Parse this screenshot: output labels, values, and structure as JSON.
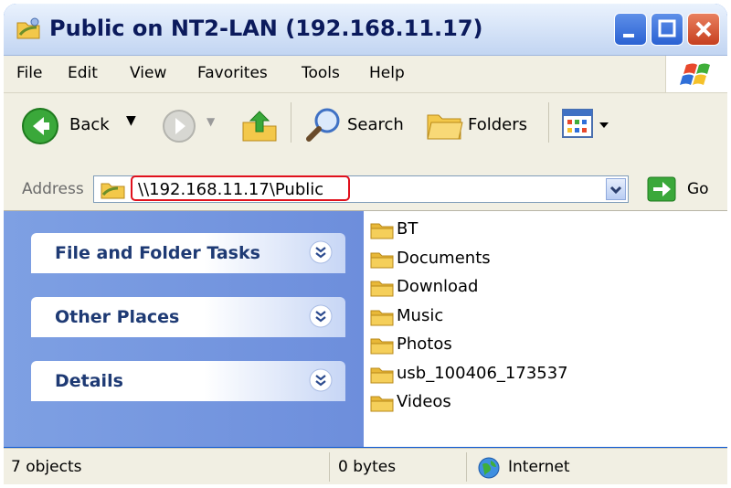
{
  "window": {
    "title": "Public on NT2-LAN (192.168.11.17)"
  },
  "menu": {
    "items": [
      "File",
      "Edit",
      "View",
      "Favorites",
      "Tools",
      "Help"
    ]
  },
  "toolbar": {
    "back_label": "Back",
    "search_label": "Search",
    "folders_label": "Folders"
  },
  "address": {
    "label": "Address",
    "value": "\\\\192.168.11.17\\Public",
    "go_label": "Go"
  },
  "tasks": [
    {
      "label": "File and Folder Tasks"
    },
    {
      "label": "Other Places"
    },
    {
      "label": "Details"
    }
  ],
  "files": [
    "BT",
    "Documents",
    "Download",
    "Music",
    "Photos",
    "usb_100406_173537",
    "Videos"
  ],
  "status": {
    "count": "7 objects",
    "size": "0 bytes",
    "zone": "Internet"
  },
  "colors": {
    "titlebar": "#d4e2f7",
    "task_pane": "#7ea0e3",
    "highlight": "#e0101c",
    "folder": "#f5cf5a"
  }
}
